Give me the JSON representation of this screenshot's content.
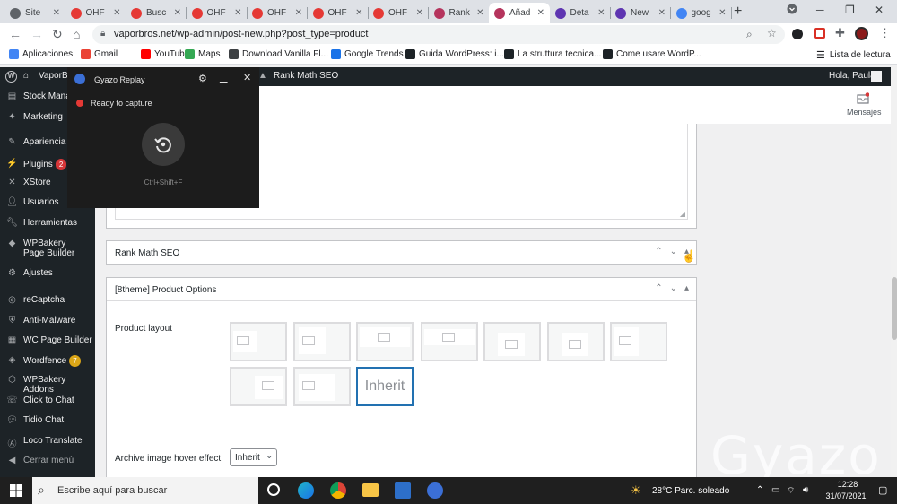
{
  "browser": {
    "tabs": [
      {
        "title": "Site",
        "icon": "globe-icon",
        "color": "#5f6368"
      },
      {
        "title": "OHF",
        "icon": "ohf-icon",
        "color": "#e53935"
      },
      {
        "title": "Busc",
        "icon": "ohf-icon",
        "color": "#e53935"
      },
      {
        "title": "OHF",
        "icon": "ohf-icon",
        "color": "#e53935"
      },
      {
        "title": "OHF",
        "icon": "ohf-icon",
        "color": "#e53935"
      },
      {
        "title": "OHF",
        "icon": "ohf-icon",
        "color": "#e53935"
      },
      {
        "title": "OHF",
        "icon": "ohf-icon",
        "color": "#e53935"
      },
      {
        "title": "Rank",
        "icon": "rankmath-icon",
        "color": "#b5345d"
      },
      {
        "title": "Añad",
        "icon": "rankmath-icon",
        "color": "#b5345d"
      },
      {
        "title": "Deta",
        "icon": "analytics-icon",
        "color": "#5e35b1"
      },
      {
        "title": "New",
        "icon": "analytics-icon",
        "color": "#5e35b1"
      },
      {
        "title": "goog",
        "icon": "google-icon",
        "color": "#4285f4"
      }
    ],
    "url": "vaporbros.net/wp-admin/post-new.php?post_type=product",
    "bookmarks": [
      {
        "label": "Aplicaciones",
        "color": "#4285f4"
      },
      {
        "label": "Gmail",
        "color": "#ea4335"
      },
      {
        "label": "YouTube",
        "color": "#ff0000"
      },
      {
        "label": "Maps",
        "color": "#34a853"
      },
      {
        "label": "Download Vanilla Fl...",
        "color": "#3c4043"
      },
      {
        "label": "Google Trends",
        "color": "#1a73e8"
      },
      {
        "label": "Guida WordPress: i...",
        "color": "#1d2327"
      },
      {
        "label": "La struttura tecnica...",
        "color": "#1d2327"
      },
      {
        "label": "Come usare WordP...",
        "color": "#1d2327"
      }
    ],
    "reading_list": "Lista de lectura"
  },
  "adminbar": {
    "site": "VaporBr",
    "plugin": "Rank Math SEO",
    "greeting": "Hola, Paula"
  },
  "gyazo": {
    "title": "Gyazo Replay",
    "status": "Ready to capture",
    "shortcut": "Ctrl+Shift+F",
    "status_color": "#e53935"
  },
  "sidebar": {
    "items": [
      {
        "label": "Stock Manag",
        "icon": "stock-icon"
      },
      {
        "label": "Marketing",
        "icon": "megaphone-icon"
      },
      {
        "label": "Apariencia",
        "icon": "paintbrush-icon"
      },
      {
        "label": "Plugins",
        "icon": "plugin-icon",
        "badge": "2"
      },
      {
        "label": "XStore",
        "icon": "xstore-icon"
      },
      {
        "label": "Usuarios",
        "icon": "users-icon"
      },
      {
        "label": "Herramientas",
        "icon": "wrench-icon"
      },
      {
        "label": "WPBakery Page Builder",
        "icon": "wpbakery-icon"
      },
      {
        "label": "Ajustes",
        "icon": "settings-icon"
      },
      {
        "label": "reCaptcha",
        "icon": "recaptcha-icon"
      },
      {
        "label": "Anti-Malware",
        "icon": "shield-icon"
      },
      {
        "label": "WC Page Builder",
        "icon": "builder-icon"
      },
      {
        "label": "Wordfence",
        "icon": "wordfence-icon",
        "badge": "7"
      },
      {
        "label": "WPBakery Addons",
        "icon": "addons-icon"
      },
      {
        "label": "Click to Chat",
        "icon": "whatsapp-icon"
      },
      {
        "label": "Tidio Chat",
        "icon": "chat-icon"
      },
      {
        "label": "Loco Translate",
        "icon": "translate-icon"
      },
      {
        "label": "Cerrar menú",
        "icon": "collapse-icon"
      }
    ]
  },
  "main": {
    "messages_label": "Mensajes",
    "rank_math_panel": "Rank Math SEO",
    "product_options_panel": "[8theme] Product Options",
    "product_layout_label": "Product layout",
    "inherit_option": "Inherit",
    "hover_effect_label": "Archive image hover effect",
    "hover_effect_value": "Inherit",
    "watermark": "Gyazo"
  },
  "taskbar": {
    "search_placeholder": "Escribe aquí para buscar",
    "weather": "28°C  Parc. soleado",
    "time": "12:28",
    "date": "31/07/2021"
  }
}
